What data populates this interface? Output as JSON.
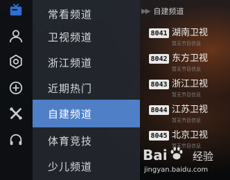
{
  "rail": {
    "icons": [
      "tv-icon",
      "user-icon",
      "settings-icon",
      "add-icon",
      "tools-icon",
      "headset-icon"
    ]
  },
  "menu": {
    "items": [
      {
        "label": "常看频道"
      },
      {
        "label": "卫视频道"
      },
      {
        "label": "浙江频道"
      },
      {
        "label": "近期热门"
      },
      {
        "label": "自建频道",
        "active": true
      },
      {
        "label": "体育竞技"
      },
      {
        "label": "少儿频道"
      }
    ]
  },
  "channel_list": {
    "header_arrows": "▶▶",
    "header": "自建频道",
    "channels": [
      {
        "number": "8041",
        "name": "湖南卫视",
        "program": "暂无节目信息"
      },
      {
        "number": "8042",
        "name": "东方卫视",
        "program": "暂无节目信息"
      },
      {
        "number": "8043",
        "name": "浙江卫视",
        "program": "暂无节目信息"
      },
      {
        "number": "8044",
        "name": "江苏卫视",
        "program": "暂无节目信息"
      },
      {
        "number": "8045",
        "name": "北京卫视",
        "program": "暂无节目信息"
      }
    ]
  },
  "watermark": {
    "logo": "Bai",
    "logo2": "经验",
    "url": "jingyan.baidu.com"
  },
  "colors": {
    "active": "#4f7fc7",
    "menu_bg": "#23282e",
    "rail_bg": "#0e1014"
  }
}
